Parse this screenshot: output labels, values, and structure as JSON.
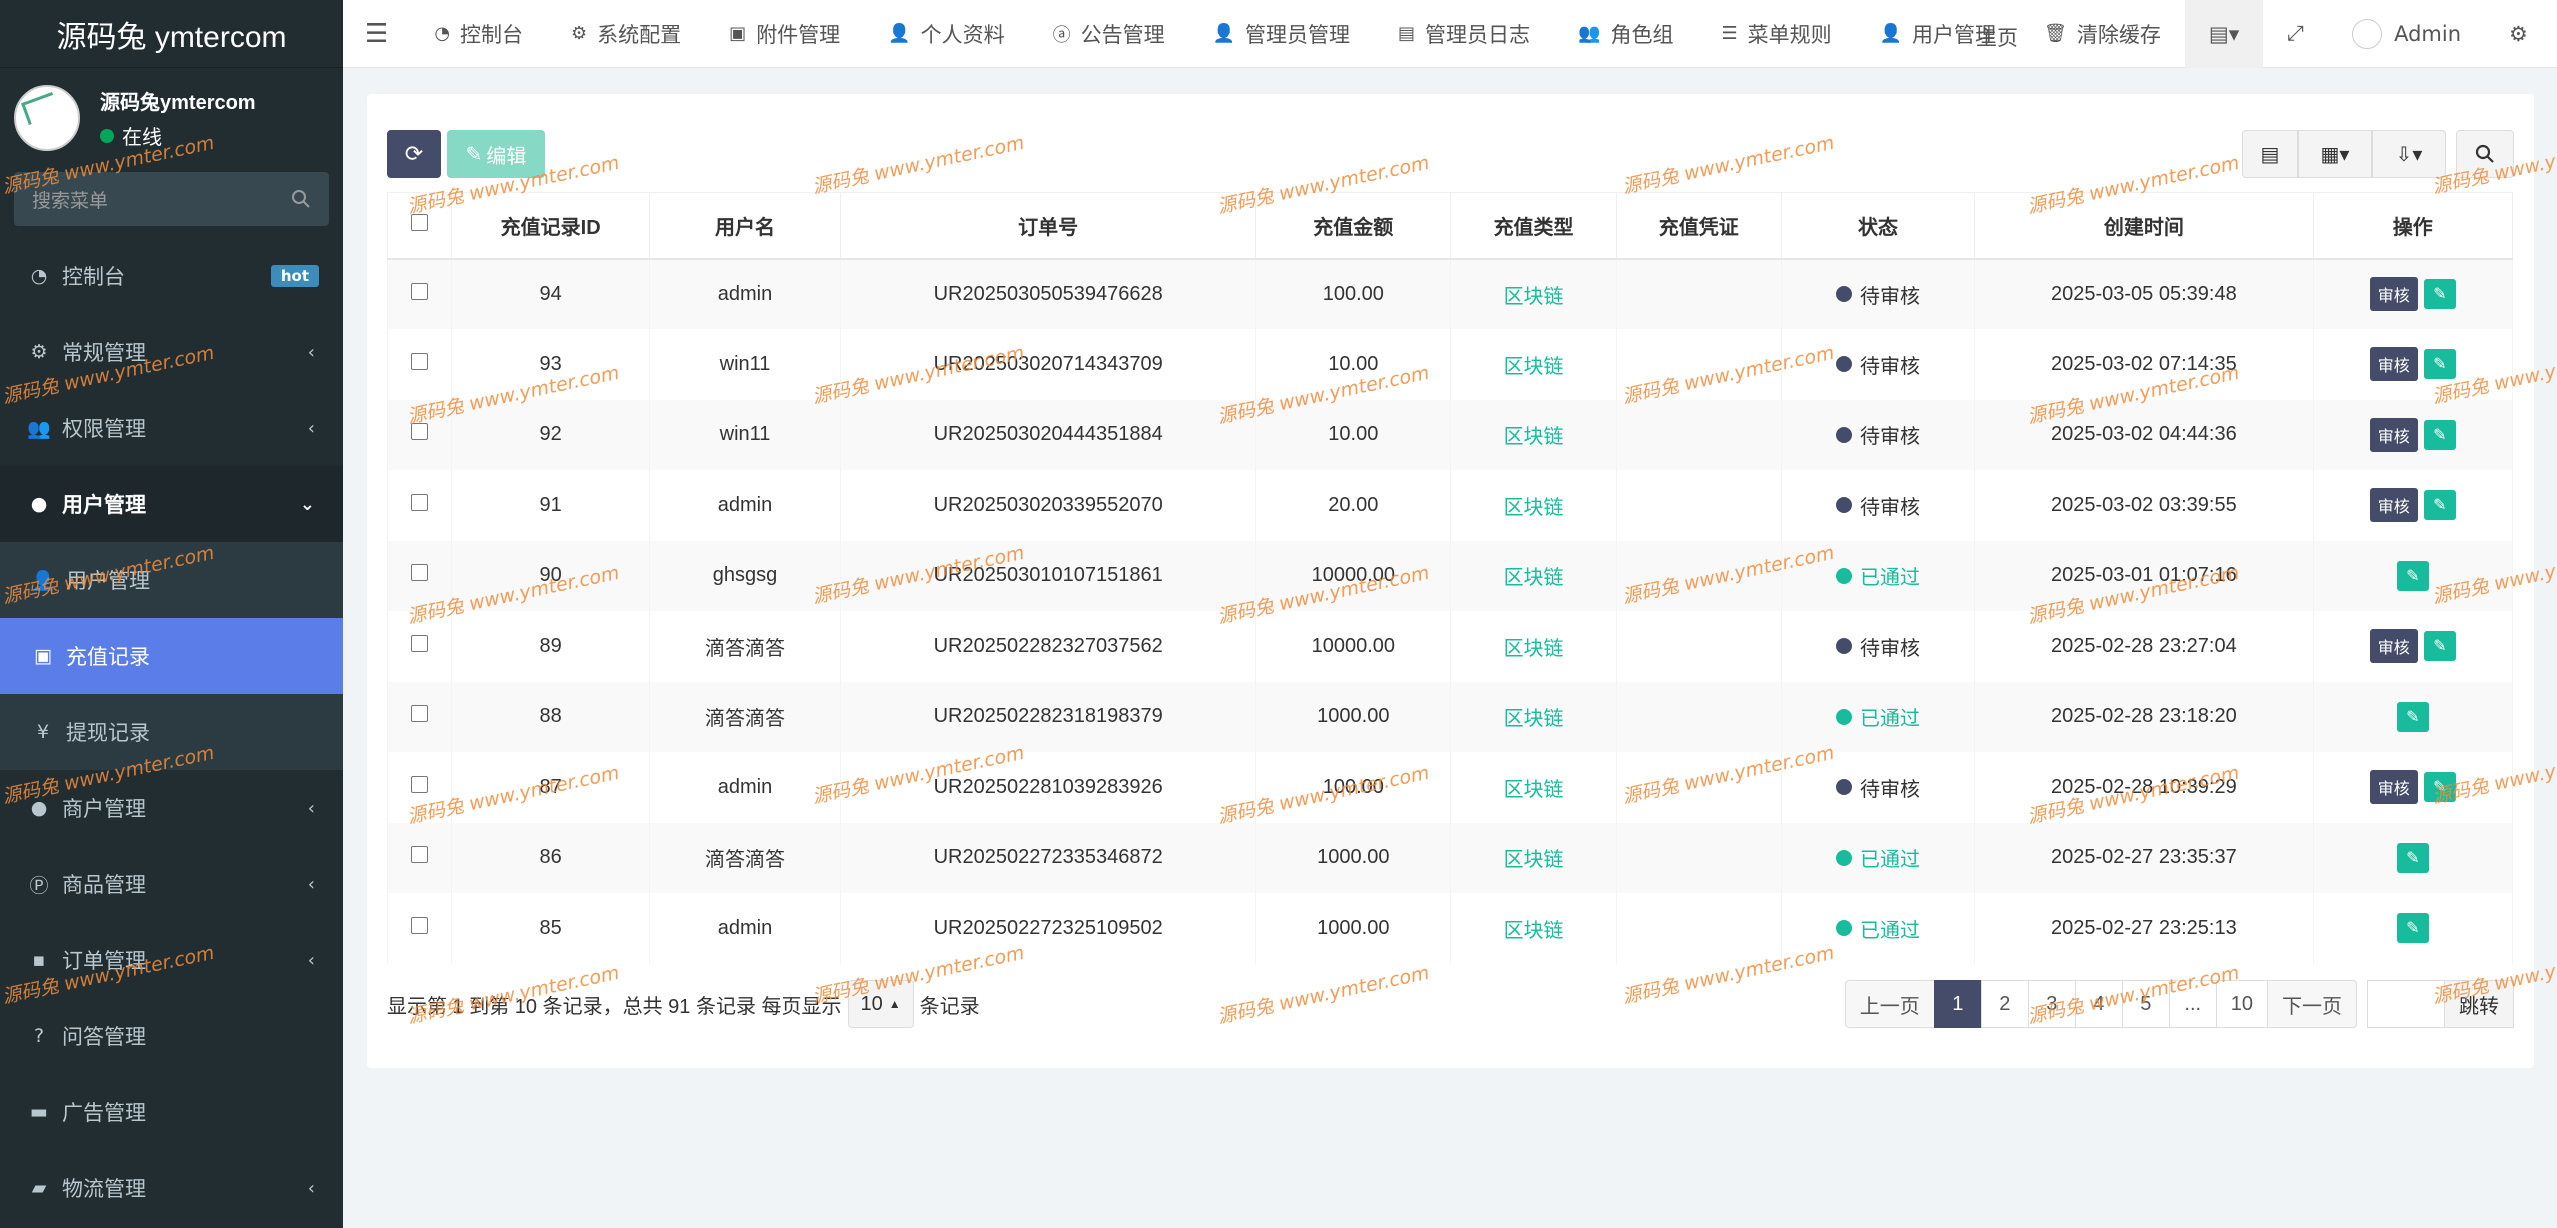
{
  "app": {
    "logo": "源码兔 ymtercom"
  },
  "user": {
    "name": "源码兔ymtercom",
    "status": "在线"
  },
  "sidebar": {
    "search_placeholder": "搜索菜单",
    "items": [
      {
        "label": "控制台",
        "icon": "dashboard-icon",
        "badge": "hot"
      },
      {
        "label": "常规管理",
        "icon": "cogs-icon"
      },
      {
        "label": "权限管理",
        "icon": "group-icon"
      },
      {
        "label": "用户管理",
        "icon": "user-circle-icon"
      },
      {
        "label": "用户管理",
        "icon": "user-icon"
      },
      {
        "label": "充值记录",
        "icon": "money-icon"
      },
      {
        "label": "提现记录",
        "icon": "yen-icon"
      },
      {
        "label": "商户管理",
        "icon": "apple-icon"
      },
      {
        "label": "商品管理",
        "icon": "product-icon"
      },
      {
        "label": "订单管理",
        "icon": "cube-icon"
      },
      {
        "label": "问答管理",
        "icon": "question-icon"
      },
      {
        "label": "广告管理",
        "icon": "ad-icon"
      },
      {
        "label": "物流管理",
        "icon": "truck-icon"
      }
    ]
  },
  "topnav": {
    "items": [
      "控制台",
      "系统配置",
      "附件管理",
      "个人资料",
      "公告管理",
      "管理员管理",
      "管理员日志",
      "角色组",
      "菜单规则",
      "用户管理",
      "清除缓存"
    ],
    "overlay": "主页",
    "admin": "Admin"
  },
  "toolbar": {
    "edit_label": "编辑"
  },
  "table": {
    "headers": [
      "充值记录ID",
      "用户名",
      "订单号",
      "充值金额",
      "充值类型",
      "充值凭证",
      "状态",
      "创建时间",
      "操作"
    ],
    "audit_label": "审核",
    "rows": [
      {
        "id": "94",
        "user": "admin",
        "order": "UR202503050539476628",
        "amount": "100.00",
        "type": "区块链",
        "proof": "",
        "status": "待审核",
        "ok": false,
        "time": "2025-03-05 05:39:48"
      },
      {
        "id": "93",
        "user": "win11",
        "order": "UR202503020714343709",
        "amount": "10.00",
        "type": "区块链",
        "proof": "",
        "status": "待审核",
        "ok": false,
        "time": "2025-03-02 07:14:35"
      },
      {
        "id": "92",
        "user": "win11",
        "order": "UR202503020444351884",
        "amount": "10.00",
        "type": "区块链",
        "proof": "",
        "status": "待审核",
        "ok": false,
        "time": "2025-03-02 04:44:36"
      },
      {
        "id": "91",
        "user": "admin",
        "order": "UR202503020339552070",
        "amount": "20.00",
        "type": "区块链",
        "proof": "",
        "status": "待审核",
        "ok": false,
        "time": "2025-03-02 03:39:55"
      },
      {
        "id": "90",
        "user": "ghsgsg",
        "order": "UR202503010107151861",
        "amount": "10000.00",
        "type": "区块链",
        "proof": "",
        "status": "已通过",
        "ok": true,
        "time": "2025-03-01 01:07:16"
      },
      {
        "id": "89",
        "user": "滴答滴答",
        "order": "UR202502282327037562",
        "amount": "10000.00",
        "type": "区块链",
        "proof": "",
        "status": "待审核",
        "ok": false,
        "time": "2025-02-28 23:27:04"
      },
      {
        "id": "88",
        "user": "滴答滴答",
        "order": "UR202502282318198379",
        "amount": "1000.00",
        "type": "区块链",
        "proof": "",
        "status": "已通过",
        "ok": true,
        "time": "2025-02-28 23:18:20"
      },
      {
        "id": "87",
        "user": "admin",
        "order": "UR202502281039283926",
        "amount": "100.00",
        "type": "区块链",
        "proof": "",
        "status": "待审核",
        "ok": false,
        "time": "2025-02-28 10:39:29"
      },
      {
        "id": "86",
        "user": "滴答滴答",
        "order": "UR202502272335346872",
        "amount": "1000.00",
        "type": "区块链",
        "proof": "",
        "status": "已通过",
        "ok": true,
        "time": "2025-02-27 23:35:37"
      },
      {
        "id": "85",
        "user": "admin",
        "order": "UR202502272325109502",
        "amount": "1000.00",
        "type": "区块链",
        "proof": "",
        "status": "已通过",
        "ok": true,
        "time": "2025-02-27 23:25:13"
      }
    ]
  },
  "footer": {
    "summary": "显示第 1 到第 10 条记录，总共 91 条记录 每页显示",
    "page_size": "10",
    "suffix": "条记录",
    "prev": "上一页",
    "pages": [
      "1",
      "2",
      "3",
      "4",
      "5",
      "...",
      "10"
    ],
    "current_page": "1",
    "next": "下一页",
    "jump": "跳转"
  },
  "watermark": {
    "site": "源码兔",
    "url": "www.ymter.com"
  },
  "colors": {
    "sidebar_bg": "#222d32",
    "active_menu": "#5b7de8",
    "primary": "#444c69",
    "success": "#18bc9c"
  }
}
